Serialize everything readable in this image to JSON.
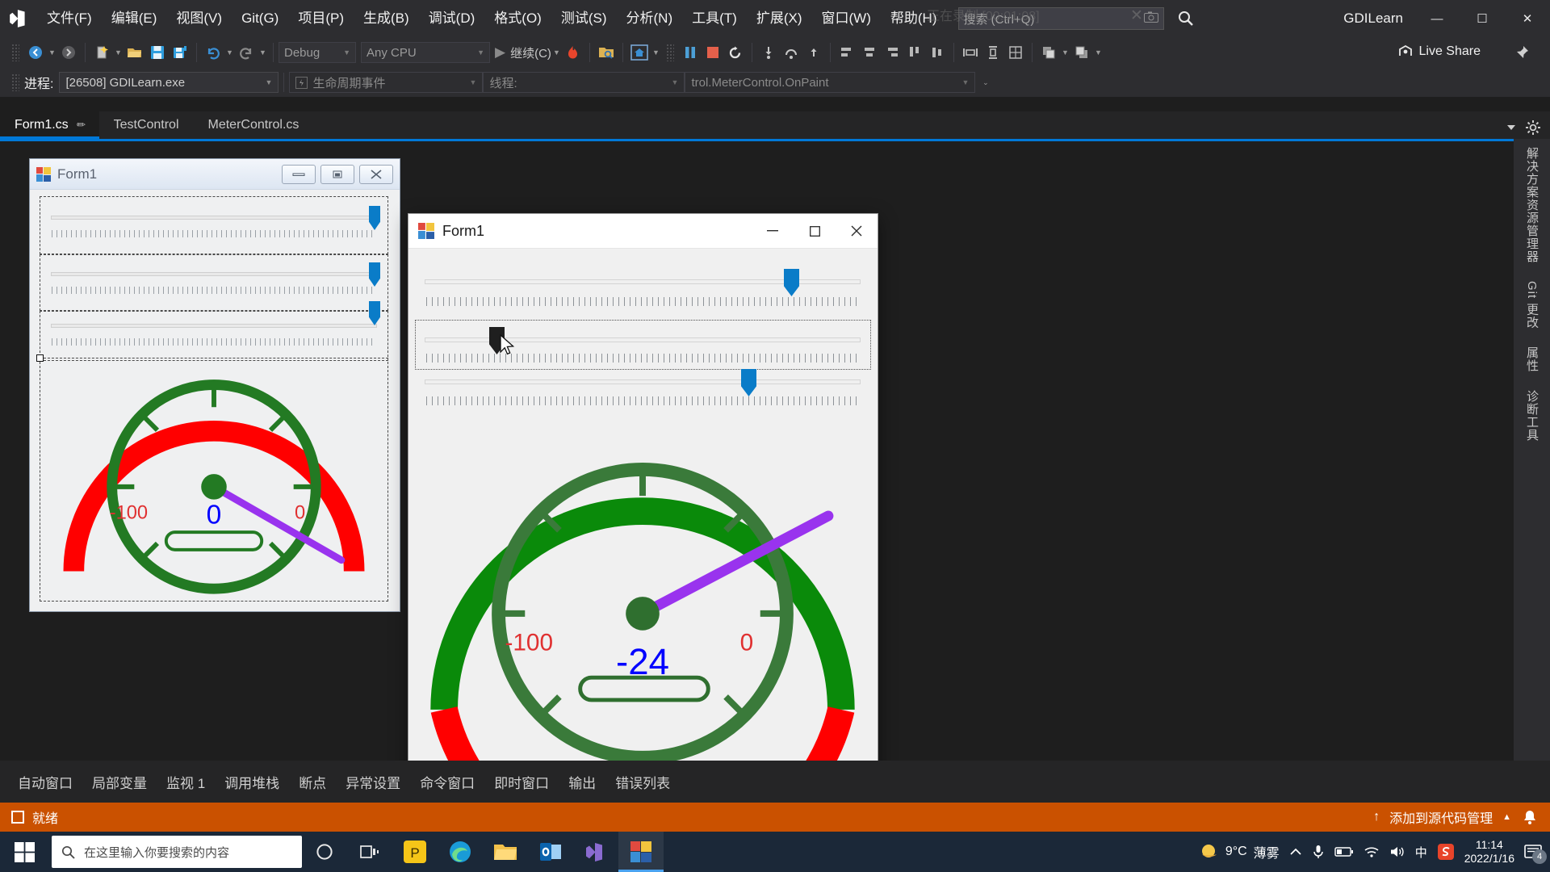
{
  "titlebar": {
    "logo_icon": "visual-studio-logo",
    "menus": [
      {
        "label": "文件(F)"
      },
      {
        "label": "编辑(E)"
      },
      {
        "label": "视图(V)"
      },
      {
        "label": "Git(G)"
      },
      {
        "label": "项目(P)"
      },
      {
        "label": "生成(B)"
      },
      {
        "label": "调试(D)"
      },
      {
        "label": "格式(O)"
      },
      {
        "label": "测试(S)"
      },
      {
        "label": "分析(N)"
      },
      {
        "label": "工具(T)"
      },
      {
        "label": "扩展(X)"
      },
      {
        "label": "窗口(W)"
      },
      {
        "label": "帮助(H)"
      }
    ],
    "search_placeholder": "搜索 (Ctrl+Q)",
    "recording_overlay": "正在录制 [00:01:08]",
    "recording_close": "✕",
    "project_name": "GDILearn",
    "minimize": "—",
    "maximize": "☐",
    "close": "✕"
  },
  "toolbar": {
    "nav_back_icon": "arrow-back-icon",
    "nav_forward_icon": "arrow-forward-icon",
    "new_item_icon": "new-item-icon",
    "open_icon": "open-folder-icon",
    "save_icon": "save-icon",
    "save_all_icon": "save-all-icon",
    "undo_icon": "undo-icon",
    "redo_icon": "redo-icon",
    "config": "Debug",
    "platform": "Any CPU",
    "run_label": "继续(C)",
    "hot_reload_icon": "hot-reload-flame-icon",
    "search_folder_icon": "search-folder-icon",
    "home_icon": "home-frame-icon",
    "pause_icon": "pause-icon",
    "stop_icon": "stop-icon",
    "restart_icon": "restart-icon",
    "live_share": "Live Share",
    "pin_icon": "pin-icon"
  },
  "toolbar2": {
    "process_label": "进程:",
    "process_value": "[26508] GDILearn.exe",
    "lifecycle_label": "生命周期事件",
    "thread_label": "线程:",
    "stack_value": "trol.MeterControl.OnPaint"
  },
  "tabs": [
    {
      "label": "Form1.cs",
      "pinned": true,
      "active": true,
      "pin_icon": "pin-icon"
    },
    {
      "label": "TestControl",
      "pinned": false,
      "active": false
    },
    {
      "label": "MeterControl.cs",
      "pinned": false,
      "active": false
    }
  ],
  "designer": {
    "title": "Form1",
    "icon": "winforms-icon",
    "minimize": "—",
    "maximize": "❐",
    "close": "✕",
    "gauge": {
      "value": "0",
      "min_label": "-100",
      "max_label": "0",
      "value_color": "#0000ff",
      "label_color": "#e03030",
      "arc_green": "#237a23",
      "arc_red": "#ff0000",
      "needle_color": "#9933ee",
      "needle_angle_deg": 42
    },
    "trackbars": [
      {
        "thumb_pct": 96
      },
      {
        "thumb_pct": 96
      },
      {
        "thumb_pct": 96
      }
    ]
  },
  "runform": {
    "title": "Form1",
    "icon": "winforms-icon",
    "minimize": "—",
    "maximize": "☐",
    "close": "✕",
    "gauge": {
      "value": "-24",
      "min_label": "-100",
      "max_label": "0",
      "value_color": "#0000ff",
      "label_color": "#e03030",
      "arc_green": "#0a8a0a",
      "arc_red": "#ff0000",
      "needle_color": "#9933ee",
      "needle_angle_deg": -46
    },
    "trackbars": [
      {
        "thumb_pct": 83,
        "focused": false,
        "dark": false
      },
      {
        "thumb_pct": 17,
        "focused": true,
        "dark": true
      },
      {
        "thumb_pct": 74,
        "focused": false,
        "dark": false
      }
    ],
    "cursor_icon": "mouse-pointer-icon"
  },
  "right_tabs": [
    {
      "label": "解决方案资源管理器"
    },
    {
      "label": "Git 更改"
    },
    {
      "label": "属性"
    },
    {
      "label": "诊断工具"
    }
  ],
  "dock_tabs": [
    {
      "label": "自动窗口"
    },
    {
      "label": "局部变量"
    },
    {
      "label": "监视 1"
    },
    {
      "label": "调用堆栈"
    },
    {
      "label": "断点"
    },
    {
      "label": "异常设置"
    },
    {
      "label": "命令窗口"
    },
    {
      "label": "即时窗口"
    },
    {
      "label": "输出"
    },
    {
      "label": "错误列表"
    }
  ],
  "statusbar": {
    "ready": "就绪",
    "status_icon": "ready-square-icon",
    "source_control": "添加到源代码管理",
    "source_caret": "▲",
    "up_arrow": "↑",
    "bell_icon": "notification-bell-icon",
    "accent_color": "#ca5100"
  },
  "taskbar": {
    "start_icon": "windows-start-icon",
    "search_placeholder": "在这里输入你要搜索的内容",
    "search_icon": "search-icon",
    "task_view_icon": "task-view-icon",
    "cortana_icon": "cortana-circle-icon",
    "pinned": [
      {
        "icon": "photoshop-icon"
      },
      {
        "icon": "edge-icon"
      },
      {
        "icon": "file-explorer-icon"
      },
      {
        "icon": "outlook-icon"
      },
      {
        "icon": "visual-studio-icon"
      },
      {
        "icon": "form1-app-icon",
        "active": true
      }
    ],
    "weather_temp": "9°C",
    "weather_desc": "薄雾",
    "weather_icon": "sun-cloud-icon",
    "tray": [
      {
        "icon": "chevron-up-icon"
      },
      {
        "icon": "microphone-icon"
      },
      {
        "icon": "battery-icon"
      },
      {
        "icon": "wifi-icon"
      },
      {
        "icon": "volume-icon"
      },
      {
        "icon": "ime-chinese-icon",
        "label": "中"
      },
      {
        "icon": "sogou-input-icon"
      }
    ],
    "time": "11:14",
    "date": "2022/1/16",
    "notification_count": "4",
    "notification_icon": "action-center-icon"
  }
}
